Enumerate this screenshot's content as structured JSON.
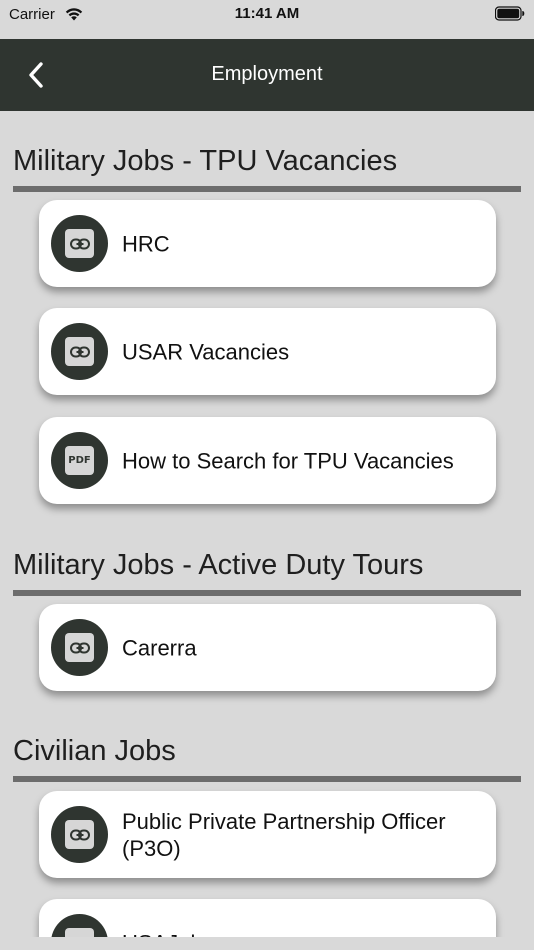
{
  "status_bar": {
    "carrier": "Carrier",
    "time": "11:41 AM",
    "wifi_icon": "wifi-icon",
    "battery_icon": "battery-icon"
  },
  "nav": {
    "title": "Employment",
    "back_icon": "chevron-left-icon"
  },
  "colors": {
    "nav_background": "#2f3530",
    "page_background": "#d9d9d9",
    "card_background": "#ffffff",
    "icon_circle": "#2f3530",
    "section_rule": "#6d6d6d"
  },
  "sections": [
    {
      "title": "Military Jobs - TPU Vacancies",
      "items": [
        {
          "label": "HRC",
          "icon": "link-icon"
        },
        {
          "label": "USAR Vacancies",
          "icon": "link-icon"
        },
        {
          "label": "How to Search for TPU Vacancies",
          "icon": "pdf-icon",
          "icon_text": "PDF"
        }
      ]
    },
    {
      "title": "Military Jobs - Active Duty Tours",
      "items": [
        {
          "label": "Carerra",
          "icon": "link-icon"
        }
      ]
    },
    {
      "title": "Civilian Jobs",
      "items": [
        {
          "label": "Public Private Partnership Officer (P3O)",
          "icon": "link-icon"
        },
        {
          "label": "USAJobs",
          "icon": "link-icon"
        }
      ]
    }
  ]
}
